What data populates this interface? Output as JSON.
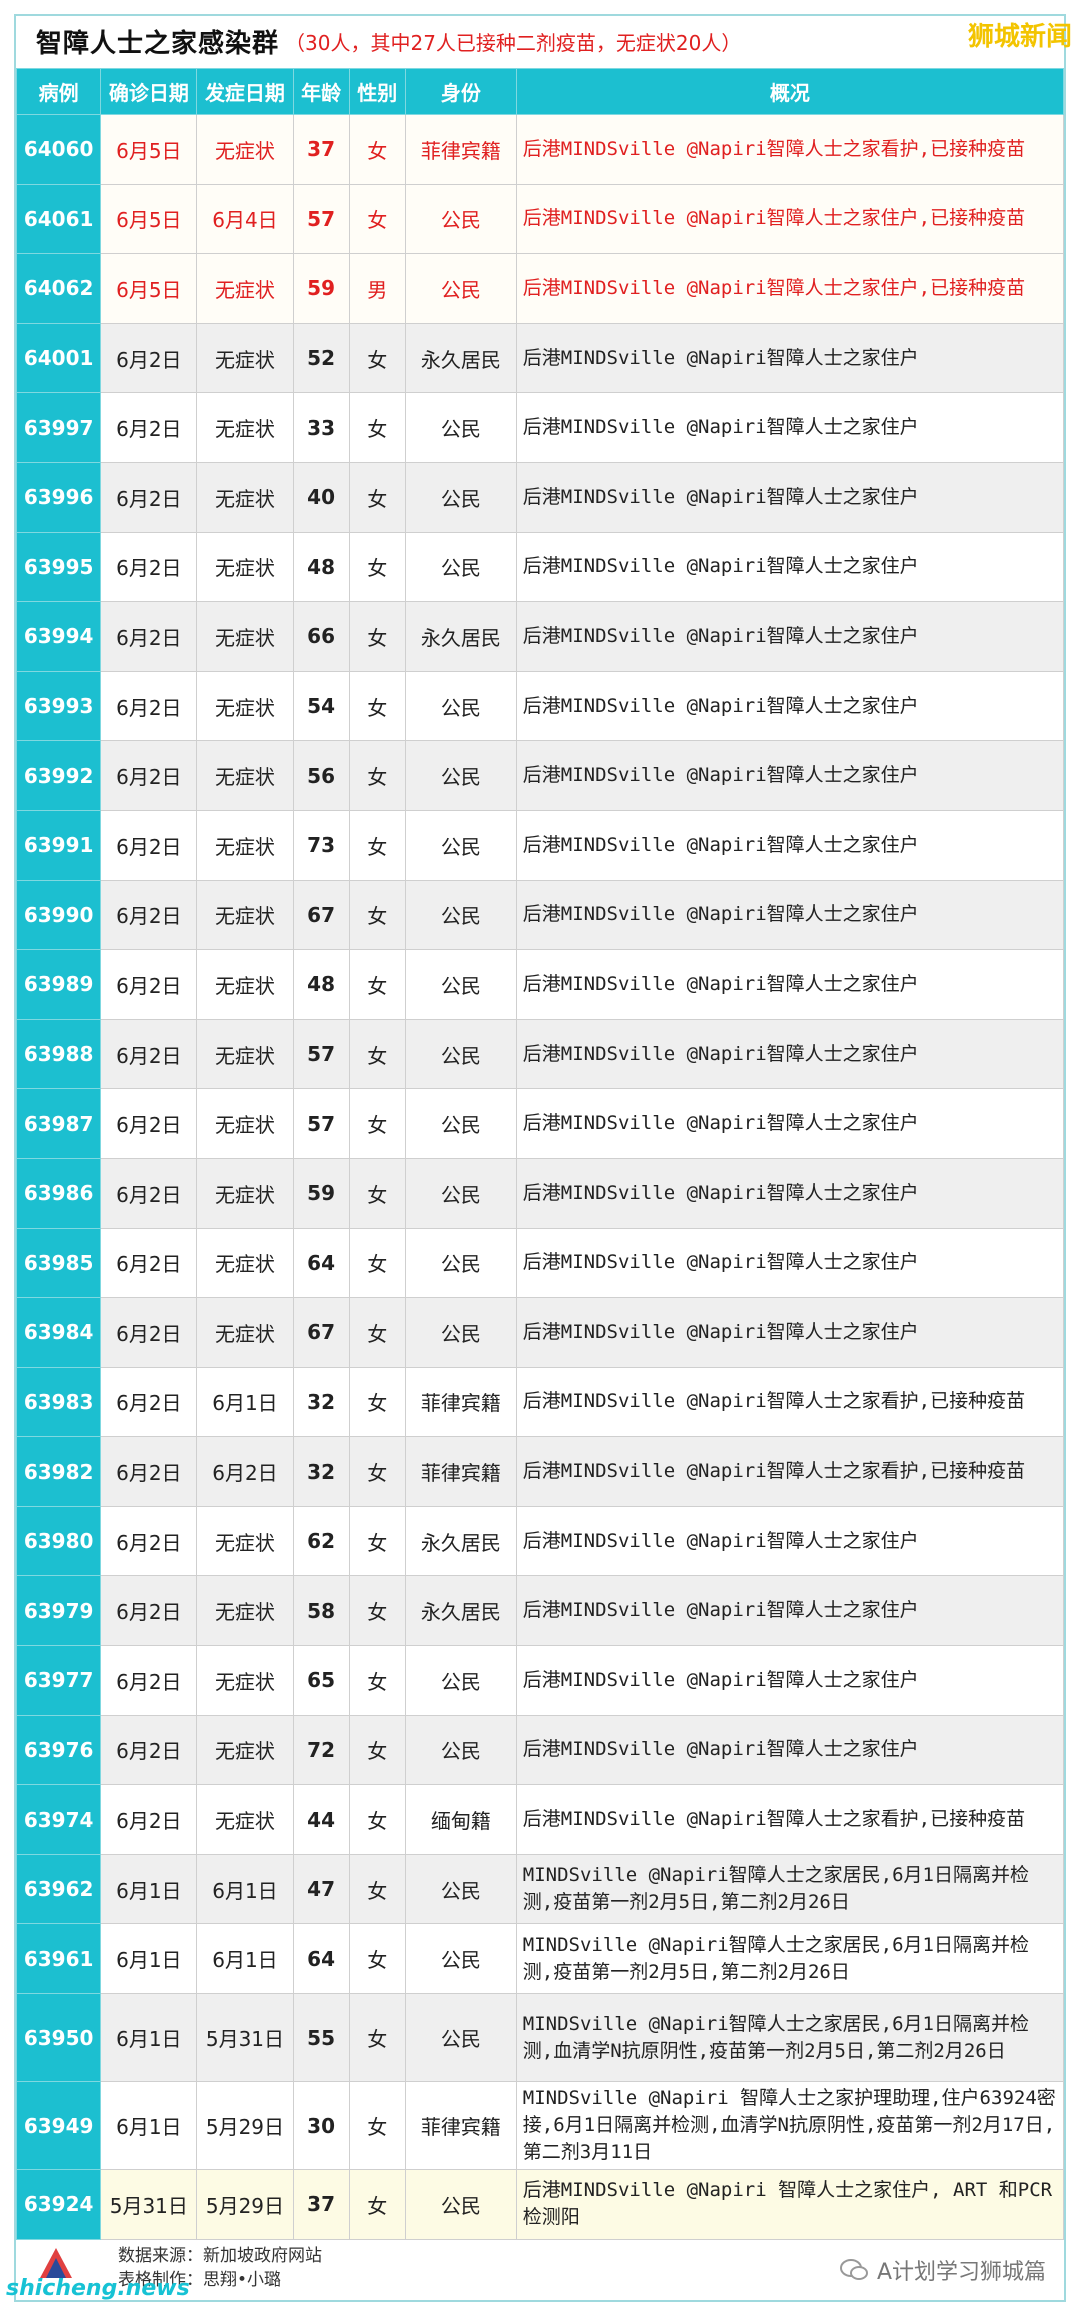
{
  "header": {
    "title": "智障人士之家感染群",
    "subtitle": "（30人，其中27人已接种二剂疫苗，无症状20人）",
    "brand": "狮城新闻"
  },
  "columns": [
    "病例",
    "确诊日期",
    "发症日期",
    "年龄",
    "性别",
    "身份",
    "概况"
  ],
  "rows": [
    {
      "id": "64060",
      "confirm": "6月5日",
      "onset": "无症状",
      "age": "37",
      "gender": "女",
      "identity": "菲律宾籍",
      "summary": "后港MINDSville @Napiri智障人士之家看护,已接种疫苗",
      "style": "new"
    },
    {
      "id": "64061",
      "confirm": "6月5日",
      "onset": "6月4日",
      "age": "57",
      "gender": "女",
      "identity": "公民",
      "summary": "后港MINDSville @Napiri智障人士之家住户,已接种疫苗",
      "style": "new"
    },
    {
      "id": "64062",
      "confirm": "6月5日",
      "onset": "无症状",
      "age": "59",
      "gender": "男",
      "identity": "公民",
      "summary": "后港MINDSville @Napiri智障人士之家住户,已接种疫苗",
      "style": "new"
    },
    {
      "id": "64001",
      "confirm": "6月2日",
      "onset": "无症状",
      "age": "52",
      "gender": "女",
      "identity": "永久居民",
      "summary": "后港MINDSville @Napiri智障人士之家住户",
      "style": "alt"
    },
    {
      "id": "63997",
      "confirm": "6月2日",
      "onset": "无症状",
      "age": "33",
      "gender": "女",
      "identity": "公民",
      "summary": "后港MINDSville @Napiri智障人士之家住户",
      "style": "plain"
    },
    {
      "id": "63996",
      "confirm": "6月2日",
      "onset": "无症状",
      "age": "40",
      "gender": "女",
      "identity": "公民",
      "summary": "后港MINDSville @Napiri智障人士之家住户",
      "style": "alt"
    },
    {
      "id": "63995",
      "confirm": "6月2日",
      "onset": "无症状",
      "age": "48",
      "gender": "女",
      "identity": "公民",
      "summary": "后港MINDSville @Napiri智障人士之家住户",
      "style": "plain"
    },
    {
      "id": "63994",
      "confirm": "6月2日",
      "onset": "无症状",
      "age": "66",
      "gender": "女",
      "identity": "永久居民",
      "summary": "后港MINDSville @Napiri智障人士之家住户",
      "style": "alt"
    },
    {
      "id": "63993",
      "confirm": "6月2日",
      "onset": "无症状",
      "age": "54",
      "gender": "女",
      "identity": "公民",
      "summary": "后港MINDSville @Napiri智障人士之家住户",
      "style": "plain"
    },
    {
      "id": "63992",
      "confirm": "6月2日",
      "onset": "无症状",
      "age": "56",
      "gender": "女",
      "identity": "公民",
      "summary": "后港MINDSville @Napiri智障人士之家住户",
      "style": "alt"
    },
    {
      "id": "63991",
      "confirm": "6月2日",
      "onset": "无症状",
      "age": "73",
      "gender": "女",
      "identity": "公民",
      "summary": "后港MINDSville @Napiri智障人士之家住户",
      "style": "plain"
    },
    {
      "id": "63990",
      "confirm": "6月2日",
      "onset": "无症状",
      "age": "67",
      "gender": "女",
      "identity": "公民",
      "summary": "后港MINDSville @Napiri智障人士之家住户",
      "style": "alt"
    },
    {
      "id": "63989",
      "confirm": "6月2日",
      "onset": "无症状",
      "age": "48",
      "gender": "女",
      "identity": "公民",
      "summary": "后港MINDSville @Napiri智障人士之家住户",
      "style": "plain"
    },
    {
      "id": "63988",
      "confirm": "6月2日",
      "onset": "无症状",
      "age": "57",
      "gender": "女",
      "identity": "公民",
      "summary": "后港MINDSville @Napiri智障人士之家住户",
      "style": "alt"
    },
    {
      "id": "63987",
      "confirm": "6月2日",
      "onset": "无症状",
      "age": "57",
      "gender": "女",
      "identity": "公民",
      "summary": "后港MINDSville @Napiri智障人士之家住户",
      "style": "plain"
    },
    {
      "id": "63986",
      "confirm": "6月2日",
      "onset": "无症状",
      "age": "59",
      "gender": "女",
      "identity": "公民",
      "summary": "后港MINDSville @Napiri智障人士之家住户",
      "style": "alt"
    },
    {
      "id": "63985",
      "confirm": "6月2日",
      "onset": "无症状",
      "age": "64",
      "gender": "女",
      "identity": "公民",
      "summary": "后港MINDSville @Napiri智障人士之家住户",
      "style": "plain"
    },
    {
      "id": "63984",
      "confirm": "6月2日",
      "onset": "无症状",
      "age": "67",
      "gender": "女",
      "identity": "公民",
      "summary": "后港MINDSville @Napiri智障人士之家住户",
      "style": "alt"
    },
    {
      "id": "63983",
      "confirm": "6月2日",
      "onset": "6月1日",
      "age": "32",
      "gender": "女",
      "identity": "菲律宾籍",
      "summary": "后港MINDSville @Napiri智障人士之家看护,已接种疫苗",
      "style": "plain"
    },
    {
      "id": "63982",
      "confirm": "6月2日",
      "onset": "6月2日",
      "age": "32",
      "gender": "女",
      "identity": "菲律宾籍",
      "summary": "后港MINDSville @Napiri智障人士之家看护,已接种疫苗",
      "style": "alt"
    },
    {
      "id": "63980",
      "confirm": "6月2日",
      "onset": "无症状",
      "age": "62",
      "gender": "女",
      "identity": "永久居民",
      "summary": "后港MINDSville @Napiri智障人士之家住户",
      "style": "plain"
    },
    {
      "id": "63979",
      "confirm": "6月2日",
      "onset": "无症状",
      "age": "58",
      "gender": "女",
      "identity": "永久居民",
      "summary": "后港MINDSville @Napiri智障人士之家住户",
      "style": "alt"
    },
    {
      "id": "63977",
      "confirm": "6月2日",
      "onset": "无症状",
      "age": "65",
      "gender": "女",
      "identity": "公民",
      "summary": "后港MINDSville @Napiri智障人士之家住户",
      "style": "plain"
    },
    {
      "id": "63976",
      "confirm": "6月2日",
      "onset": "无症状",
      "age": "72",
      "gender": "女",
      "identity": "公民",
      "summary": "后港MINDSville @Napiri智障人士之家住户",
      "style": "alt"
    },
    {
      "id": "63974",
      "confirm": "6月2日",
      "onset": "无症状",
      "age": "44",
      "gender": "女",
      "identity": "缅甸籍",
      "summary": "后港MINDSville @Napiri智障人士之家看护,已接种疫苗",
      "style": "plain"
    },
    {
      "id": "63962",
      "confirm": "6月1日",
      "onset": "6月1日",
      "age": "47",
      "gender": "女",
      "identity": "公民",
      "summary": "MINDSville @Napiri智障人士之家居民,6月1日隔离并检测,疫苗第一剂2月5日,第二剂2月26日",
      "style": "alt"
    },
    {
      "id": "63961",
      "confirm": "6月1日",
      "onset": "6月1日",
      "age": "64",
      "gender": "女",
      "identity": "公民",
      "summary": "MINDSville @Napiri智障人士之家居民,6月1日隔离并检测,疫苗第一剂2月5日,第二剂2月26日",
      "style": "plain"
    },
    {
      "id": "63950",
      "confirm": "6月1日",
      "onset": "5月31日",
      "age": "55",
      "gender": "女",
      "identity": "公民",
      "summary": "MINDSville @Napiri智障人士之家居民,6月1日隔离并检测,血清学N抗原阴性,疫苗第一剂2月5日,第二剂2月26日",
      "style": "alt tall"
    },
    {
      "id": "63949",
      "confirm": "6月1日",
      "onset": "5月29日",
      "age": "30",
      "gender": "女",
      "identity": "菲律宾籍",
      "summary": "MINDSville @Napiri 智障人士之家护理助理,住户63924密接,6月1日隔离并检测,血清学N抗原阴性,疫苗第一剂2月17日,第二剂3月11日",
      "style": "plain tall"
    },
    {
      "id": "63924",
      "confirm": "5月31日",
      "onset": "5月29日",
      "age": "37",
      "gender": "女",
      "identity": "公民",
      "summary": "后港MINDSville @Napiri 智障人士之家住户, ART 和PCR检测阳",
      "style": "hl"
    }
  ],
  "footer": {
    "source": "数据来源：新加坡政府网站",
    "maker": "表格制作：思翔•小璐",
    "wechat": "A计划学习狮城篇",
    "site": "shicheng.news"
  }
}
